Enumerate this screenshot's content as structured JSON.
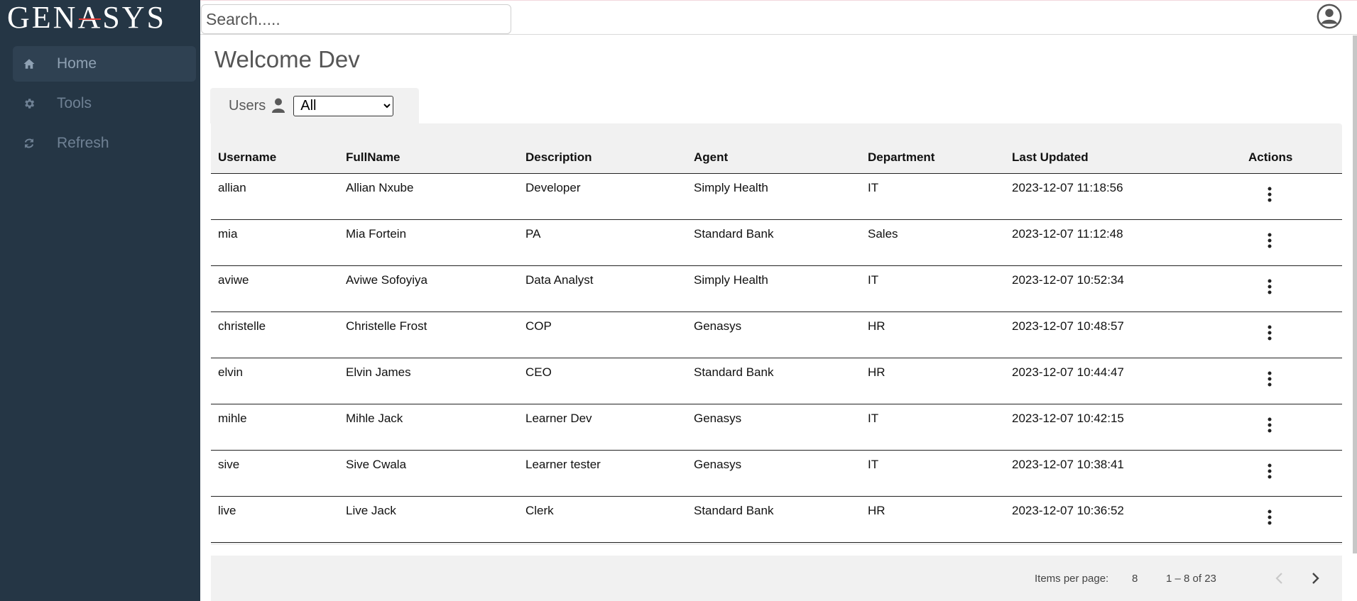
{
  "brand": {
    "logo_text": "GENASYS"
  },
  "sidebar": {
    "items": [
      {
        "label": "Home",
        "icon": "home-icon",
        "active": true
      },
      {
        "label": "Tools",
        "icon": "gear-icon",
        "active": false
      },
      {
        "label": "Refresh",
        "icon": "refresh-icon",
        "active": false
      }
    ]
  },
  "topbar": {
    "search_placeholder": "Search.....",
    "user_icon": "account-circle-icon"
  },
  "main": {
    "welcome": "Welcome Dev",
    "filter": {
      "label": "Users",
      "icon": "person-icon",
      "selected": "All"
    }
  },
  "table": {
    "headers": [
      "Username",
      "FullName",
      "Description",
      "Agent",
      "Department",
      "Last Updated",
      "Actions"
    ],
    "rows": [
      [
        "allian",
        "Allian Nxube",
        "Developer",
        "Simply Health",
        "IT",
        "2023-12-07 11:18:56"
      ],
      [
        "mia",
        "Mia Fortein",
        "PA",
        "Standard Bank",
        "Sales",
        "2023-12-07 11:12:48"
      ],
      [
        "aviwe",
        "Aviwe Sofoyiya",
        "Data Analyst",
        "Simply Health",
        "IT",
        "2023-12-07 10:52:34"
      ],
      [
        "christelle",
        "Christelle Frost",
        "COP",
        "Genasys",
        "HR",
        "2023-12-07 10:48:57"
      ],
      [
        "elvin",
        "Elvin James",
        "CEO",
        "Standard Bank",
        "HR",
        "2023-12-07 10:44:47"
      ],
      [
        "mihle",
        "Mihle Jack",
        "Learner Dev",
        "Genasys",
        "IT",
        "2023-12-07 10:42:15"
      ],
      [
        "sive",
        "Sive Cwala",
        "Learner tester",
        "Genasys",
        "IT",
        "2023-12-07 10:38:41"
      ],
      [
        "live",
        "Live Jack",
        "Clerk",
        "Standard Bank",
        "HR",
        "2023-12-07 10:36:52"
      ]
    ]
  },
  "paginator": {
    "items_per_page_label": "Items per page:",
    "items_per_page": "8",
    "range_label": "1 – 8 of 23"
  },
  "colors": {
    "sidebar_bg": "#253645",
    "panel_bg": "#f1f1f1",
    "logo_accent": "#e53935"
  }
}
